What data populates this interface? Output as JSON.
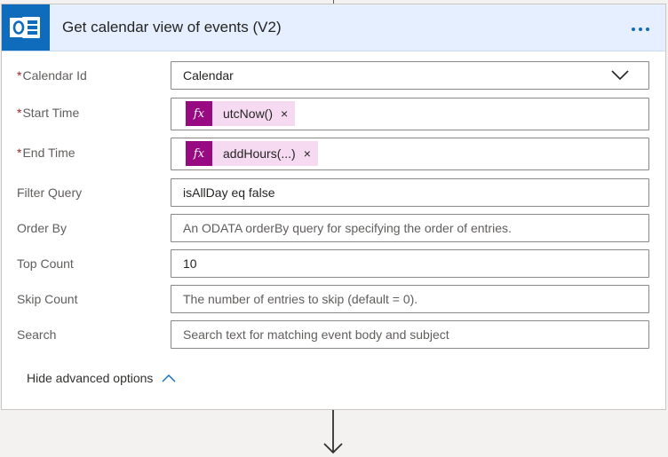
{
  "card": {
    "title": "Get calendar view of events (V2)",
    "icon": "outlook-icon",
    "more_icon": "more-icon",
    "accent_color": "#0f6cbd",
    "header_color": "#e5efff"
  },
  "required_marker": "*",
  "fields": {
    "calendar_id": {
      "label": "Calendar Id",
      "required": true,
      "value": "Calendar"
    },
    "start_time": {
      "label": "Start Time",
      "required": true,
      "token_icon": "fx",
      "token_label": "utcNow()",
      "token_remove": "×"
    },
    "end_time": {
      "label": "End Time",
      "required": true,
      "token_icon": "fx",
      "token_label": "addHours(...)",
      "token_remove": "×"
    },
    "filter_query": {
      "label": "Filter Query",
      "value": "isAllDay eq false"
    },
    "order_by": {
      "label": "Order By",
      "placeholder": "An ODATA orderBy query for specifying the order of entries."
    },
    "top_count": {
      "label": "Top Count",
      "value": "10"
    },
    "skip_count": {
      "label": "Skip Count",
      "placeholder": "The number of entries to skip (default = 0)."
    },
    "search": {
      "label": "Search",
      "placeholder": "Search text for matching event body and subject"
    }
  },
  "advanced_toggle": {
    "label": "Hide advanced options",
    "icon": "chevron-up-icon"
  },
  "connector": {
    "icon": "arrow-down-icon"
  },
  "colors": {
    "required": "#a4262c",
    "token_bg": "#f5daf1",
    "token_icon_bg": "#970a82"
  }
}
